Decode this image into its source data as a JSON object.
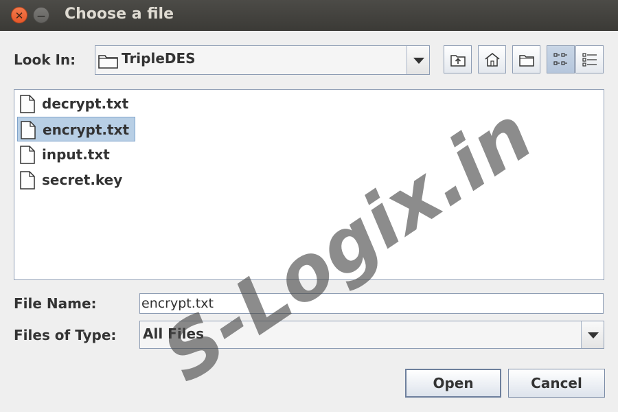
{
  "window": {
    "title": "Choose a file"
  },
  "look_in": {
    "label": "Look In:",
    "value": "TripleDES"
  },
  "toolbar": {
    "icons": [
      "up-folder-icon",
      "home-icon",
      "new-folder-icon",
      "list-view-icon",
      "details-view-icon"
    ]
  },
  "files": [
    {
      "name": "decrypt.txt",
      "selected": false
    },
    {
      "name": "encrypt.txt",
      "selected": true
    },
    {
      "name": "input.txt",
      "selected": false
    },
    {
      "name": "secret.key",
      "selected": false
    }
  ],
  "file_name": {
    "label": "File Name:",
    "value": "encrypt.txt"
  },
  "file_type": {
    "label": "Files of Type:",
    "value": "All Files"
  },
  "buttons": {
    "open": "Open",
    "cancel": "Cancel"
  },
  "watermark": {
    "text": "S-Logix.in"
  },
  "colors": {
    "titlebar": "#3b3a36",
    "selection": "#b8cfe5",
    "border": "#8e9db4"
  }
}
